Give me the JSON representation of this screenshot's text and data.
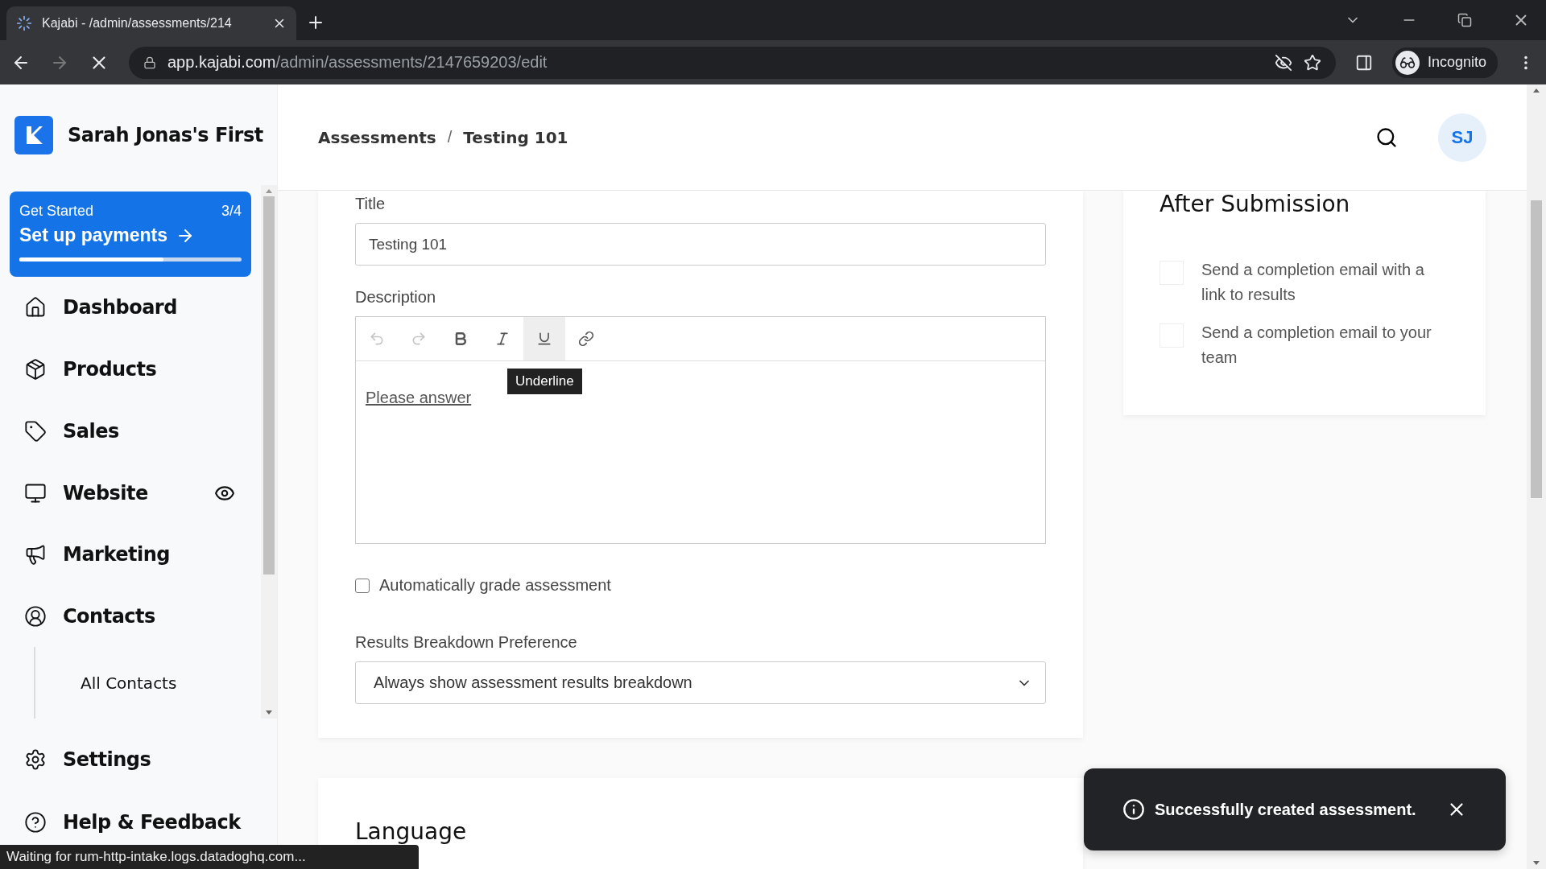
{
  "browser": {
    "tab_title": "Kajabi - /admin/assessments/214",
    "url_host": "app.kajabi.com",
    "url_path": "/admin/assessments/2147659203/edit",
    "profile": "Incognito",
    "status": "Waiting for rum-http-intake.logs.datadoghq.com..."
  },
  "sidebar": {
    "brand": "Sarah Jonas's First",
    "get_started": {
      "label": "Get Started",
      "count": "3/4",
      "action": "Set up payments",
      "level": 0.65
    },
    "items": [
      {
        "label": "Dashboard"
      },
      {
        "label": "Products"
      },
      {
        "label": "Sales"
      },
      {
        "label": "Website",
        "preview": true
      },
      {
        "label": "Marketing"
      },
      {
        "label": "Contacts",
        "children": [
          {
            "label": "All Contacts"
          }
        ]
      }
    ],
    "footer_items": [
      {
        "label": "Settings"
      },
      {
        "label": "Help & Feedback"
      }
    ]
  },
  "header": {
    "breadcrumb": [
      "Assessments",
      "Testing 101"
    ],
    "separator": "/",
    "avatar": "SJ"
  },
  "form": {
    "title_label": "Title",
    "title_value": "Testing 101",
    "description_label": "Description",
    "toolbar": [
      {
        "kind": "undo",
        "disabled": true,
        "hovered": false
      },
      {
        "kind": "redo",
        "disabled": true,
        "hovered": false
      },
      {
        "kind": "bold",
        "disabled": false,
        "hovered": false
      },
      {
        "kind": "italic",
        "disabled": false,
        "hovered": false
      },
      {
        "kind": "underline",
        "disabled": false,
        "hovered": true
      },
      {
        "kind": "link",
        "disabled": false,
        "hovered": false
      }
    ],
    "tooltip": "Underline",
    "description_text": "Please answer",
    "auto_grade": {
      "label": "Automatically grade assessment",
      "checked": false
    },
    "results_label": "Results Breakdown Preference",
    "results_value": "Always show assessment results breakdown"
  },
  "language": {
    "heading": "Language"
  },
  "after_submission": {
    "heading": "After Submission",
    "options": [
      {
        "label": "Send a completion email with a link to results",
        "checked": false
      },
      {
        "label": "Send a completion email to your team",
        "checked": false
      }
    ]
  },
  "toast": {
    "message": "Successfully created assessment."
  }
}
